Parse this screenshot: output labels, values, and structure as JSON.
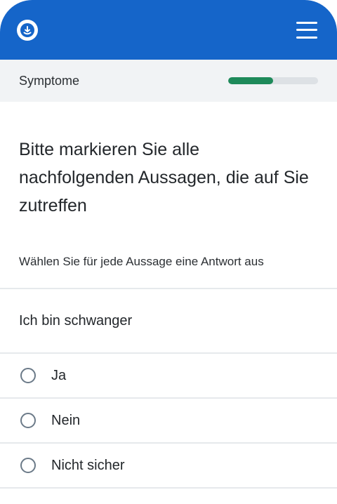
{
  "header": {
    "logo_icon": "doctor-logo-icon",
    "menu_icon": "hamburger-menu-icon",
    "brand_color": "#1565c9"
  },
  "progress": {
    "section_label": "Symptome",
    "fraction": 0.5,
    "fill_color": "#1e8a5a"
  },
  "question": {
    "title": "Bitte markieren Sie alle nachfolgenden Aussagen, die auf Sie zutreffen",
    "hint": "Wählen Sie für jede Aussage eine Antwort aus"
  },
  "statement": {
    "text": "Ich bin schwanger",
    "options": [
      {
        "label": "Ja"
      },
      {
        "label": "Nein"
      },
      {
        "label": "Nicht sicher"
      }
    ]
  }
}
